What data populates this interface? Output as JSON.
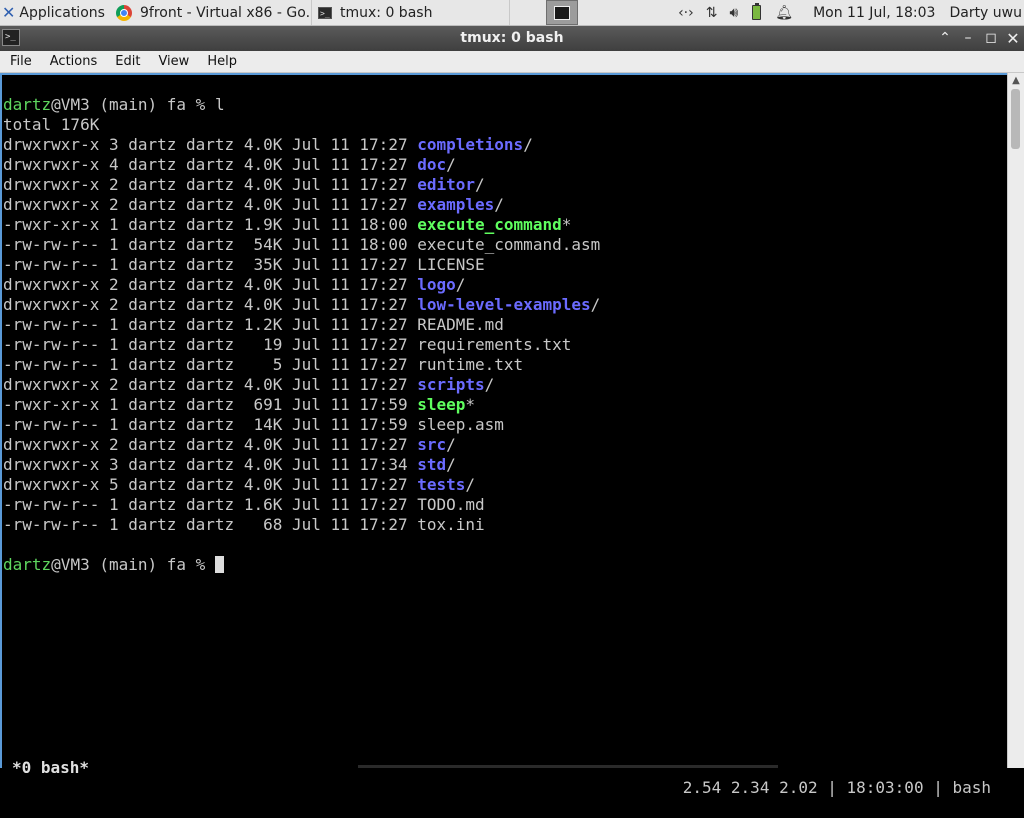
{
  "panel": {
    "applications_label": "Applications",
    "tasks": [
      {
        "label": "9front - Virtual x86 - Go..."
      },
      {
        "label": "tmux: 0 bash"
      }
    ],
    "tray_icons": [
      "network-arrows-icon",
      "transfer-updown-icon",
      "volume-icon",
      "battery-icon",
      "bell-icon"
    ],
    "clock": "Mon 11 Jul, 18:03",
    "user": "Darty uwu"
  },
  "window": {
    "title": "tmux: 0 bash",
    "buttons": {
      "shade": "⌃",
      "minimize": "–",
      "maximize": "◻",
      "close": "✕"
    }
  },
  "menubar": {
    "file": "File",
    "actions": "Actions",
    "edit": "Edit",
    "view": "View",
    "help": "Help"
  },
  "terminal": {
    "prompt_user": "dartz",
    "prompt_rest": "@VM3 (main) fa % ",
    "command": "l",
    "total_line": "total 176K",
    "entries": [
      {
        "meta": "drwxrwxr-x 3 dartz dartz 4.0K Jul 11 17:27 ",
        "name": "completions",
        "suffix": "/",
        "kind": "dir"
      },
      {
        "meta": "drwxrwxr-x 4 dartz dartz 4.0K Jul 11 17:27 ",
        "name": "doc",
        "suffix": "/",
        "kind": "dir"
      },
      {
        "meta": "drwxrwxr-x 2 dartz dartz 4.0K Jul 11 17:27 ",
        "name": "editor",
        "suffix": "/",
        "kind": "dir"
      },
      {
        "meta": "drwxrwxr-x 2 dartz dartz 4.0K Jul 11 17:27 ",
        "name": "examples",
        "suffix": "/",
        "kind": "dir"
      },
      {
        "meta": "-rwxr-xr-x 1 dartz dartz 1.9K Jul 11 18:00 ",
        "name": "execute_command",
        "suffix": "*",
        "kind": "exe"
      },
      {
        "meta": "-rw-rw-r-- 1 dartz dartz  54K Jul 11 18:00 ",
        "name": "execute_command.asm",
        "suffix": "",
        "kind": "file"
      },
      {
        "meta": "-rw-rw-r-- 1 dartz dartz  35K Jul 11 17:27 ",
        "name": "LICENSE",
        "suffix": "",
        "kind": "file"
      },
      {
        "meta": "drwxrwxr-x 2 dartz dartz 4.0K Jul 11 17:27 ",
        "name": "logo",
        "suffix": "/",
        "kind": "dir"
      },
      {
        "meta": "drwxrwxr-x 2 dartz dartz 4.0K Jul 11 17:27 ",
        "name": "low-level-examples",
        "suffix": "/",
        "kind": "dir"
      },
      {
        "meta": "-rw-rw-r-- 1 dartz dartz 1.2K Jul 11 17:27 ",
        "name": "README.md",
        "suffix": "",
        "kind": "file"
      },
      {
        "meta": "-rw-rw-r-- 1 dartz dartz   19 Jul 11 17:27 ",
        "name": "requirements.txt",
        "suffix": "",
        "kind": "file"
      },
      {
        "meta": "-rw-rw-r-- 1 dartz dartz    5 Jul 11 17:27 ",
        "name": "runtime.txt",
        "suffix": "",
        "kind": "file"
      },
      {
        "meta": "drwxrwxr-x 2 dartz dartz 4.0K Jul 11 17:27 ",
        "name": "scripts",
        "suffix": "/",
        "kind": "dir"
      },
      {
        "meta": "-rwxr-xr-x 1 dartz dartz  691 Jul 11 17:59 ",
        "name": "sleep",
        "suffix": "*",
        "kind": "exe"
      },
      {
        "meta": "-rw-rw-r-- 1 dartz dartz  14K Jul 11 17:59 ",
        "name": "sleep.asm",
        "suffix": "",
        "kind": "file"
      },
      {
        "meta": "drwxrwxr-x 2 dartz dartz 4.0K Jul 11 17:27 ",
        "name": "src",
        "suffix": "/",
        "kind": "dir"
      },
      {
        "meta": "drwxrwxr-x 3 dartz dartz 4.0K Jul 11 17:34 ",
        "name": "std",
        "suffix": "/",
        "kind": "dir"
      },
      {
        "meta": "drwxrwxr-x 5 dartz dartz 4.0K Jul 11 17:27 ",
        "name": "tests",
        "suffix": "/",
        "kind": "dir"
      },
      {
        "meta": "-rw-rw-r-- 1 dartz dartz 1.6K Jul 11 17:27 ",
        "name": "TODO.md",
        "suffix": "",
        "kind": "file"
      },
      {
        "meta": "-rw-rw-r-- 1 dartz dartz   68 Jul 11 17:27 ",
        "name": "tox.ini",
        "suffix": "",
        "kind": "file"
      }
    ]
  },
  "tmux_status": {
    "left": "*0 bash*",
    "right": "2.54 2.34 2.02 | 18:03:00 | bash"
  },
  "colors": {
    "prompt_user": "#5fd75f",
    "directory": "#6b6bff",
    "executable": "#5fff5f",
    "text": "#c8c8c8",
    "titlebar": "#4a4a4a",
    "focus_border": "#5a9ad8"
  }
}
